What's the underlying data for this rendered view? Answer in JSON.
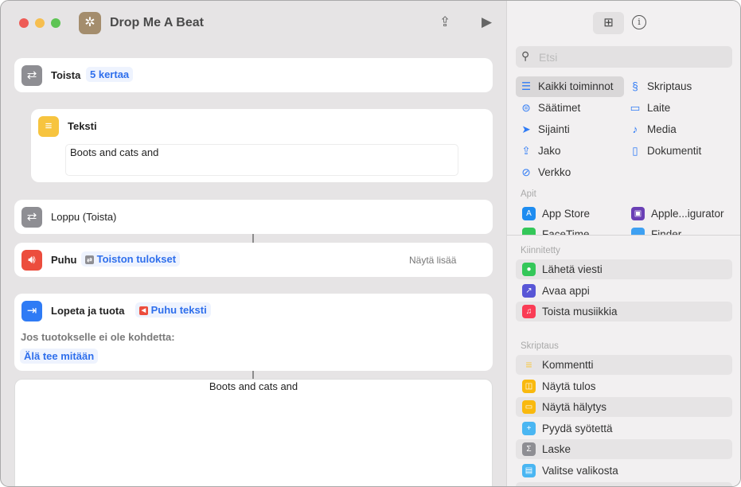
{
  "window": {
    "title": "Drop Me A Beat"
  },
  "editor": {
    "repeat": {
      "label": "Toista",
      "param": "5 kertaa"
    },
    "text": {
      "label": "Teksti",
      "value": "Boots and cats and"
    },
    "end_repeat": {
      "label": "Loppu (Toista)"
    },
    "speak": {
      "label": "Puhu",
      "param": "Toiston tulokset",
      "more": "Näytä lisää"
    },
    "stop": {
      "label": "Lopeta ja tuota",
      "param": "Puhu teksti",
      "note": "Jos tuotokselle ei ole kohdetta:",
      "option": "Älä tee mitään"
    },
    "output": {
      "text": "Boots and cats and"
    }
  },
  "sidebar": {
    "search_placeholder": "Etsi",
    "categories": [
      {
        "label": "Kaikki toiminnot",
        "icon": "list-icon"
      },
      {
        "label": "Skriptaus",
        "icon": "script-icon"
      },
      {
        "label": "Säätimet",
        "icon": "toggle-icon"
      },
      {
        "label": "Laite",
        "icon": "display-icon"
      },
      {
        "label": "Sijainti",
        "icon": "location-icon"
      },
      {
        "label": "Media",
        "icon": "music-note-icon"
      },
      {
        "label": "Jako",
        "icon": "share-icon"
      },
      {
        "label": "Dokumentit",
        "icon": "document-icon"
      },
      {
        "label": "Verkko",
        "icon": "compass-icon"
      }
    ],
    "apps_header": "Apit",
    "apps": [
      {
        "label": "App Store"
      },
      {
        "label": "Apple...igurator"
      },
      {
        "label": "FaceTime"
      },
      {
        "label": "Finder"
      }
    ],
    "pinned_header": "Kiinnitetty",
    "pinned": [
      {
        "label": "Lähetä viesti",
        "color": "#34c759"
      },
      {
        "label": "Avaa appi",
        "color": "#5856d6"
      },
      {
        "label": "Toista musiikkia",
        "color": "#fa3c55"
      }
    ],
    "scripting_header": "Skriptaus",
    "scripting": [
      {
        "label": "Kommentti",
        "color": "#f7c948"
      },
      {
        "label": "Näytä tulos",
        "color": "#f9b90e"
      },
      {
        "label": "Näytä hälytys",
        "color": "#f9b90e"
      },
      {
        "label": "Pyydä syötettä",
        "color": "#4ab6f2"
      },
      {
        "label": "Laske",
        "color": "#8e8e93"
      },
      {
        "label": "Valitse valikosta",
        "color": "#4ab6f2"
      }
    ]
  }
}
